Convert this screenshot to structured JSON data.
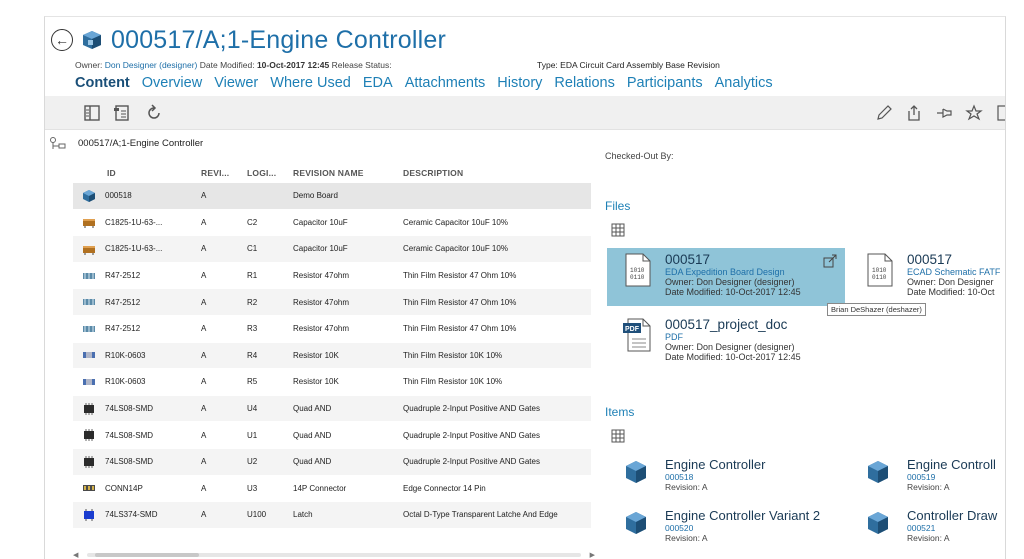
{
  "header": {
    "title": "000517/A;1-Engine Controller",
    "owner_label": "Owner:",
    "owner_value": "Don Designer (designer)",
    "date_label": "Date Modified:",
    "date_value": "10-Oct-2017 12:45",
    "release_label": "Release Status:",
    "type_label": "Type:",
    "type_value": "EDA Circuit Card Assembly Base Revision"
  },
  "tabs": [
    {
      "label": "Content"
    },
    {
      "label": "Overview"
    },
    {
      "label": "Viewer"
    },
    {
      "label": "Where Used"
    },
    {
      "label": "EDA"
    },
    {
      "label": "Attachments"
    },
    {
      "label": "History"
    },
    {
      "label": "Relations"
    },
    {
      "label": "Participants"
    },
    {
      "label": "Analytics"
    }
  ],
  "toolbar": {
    "left_icons": [
      "panel-icon",
      "structure-icon",
      "refresh-icon"
    ],
    "right_icons": [
      "pencil-icon",
      "share-icon",
      "pin-icon",
      "star-icon",
      "page-icon"
    ]
  },
  "breadcrumb": {
    "text": "000517/A;1-Engine Controller"
  },
  "table": {
    "columns": [
      "ID",
      "REVI...",
      "LOGI...",
      "REVISION NAME",
      "DESCRIPTION"
    ],
    "rows": [
      {
        "icon": "assembly",
        "id": "000518",
        "rev": "A",
        "logical": "",
        "name": "Demo Board",
        "desc": ""
      },
      {
        "icon": "capacitor",
        "id": "C1825-1U-63-...",
        "rev": "A",
        "logical": "C2",
        "name": "Capacitor 10uF",
        "desc": "Ceramic Capacitor 10uF 10%"
      },
      {
        "icon": "capacitor",
        "id": "C1825-1U-63-...",
        "rev": "A",
        "logical": "C1",
        "name": "Capacitor 10uF",
        "desc": "Ceramic Capacitor 10uF 10%"
      },
      {
        "icon": "resistor",
        "id": "R47-2512",
        "rev": "A",
        "logical": "R1",
        "name": "Resistor 47ohm",
        "desc": "Thin Film Resistor 47 Ohm 10%"
      },
      {
        "icon": "resistor",
        "id": "R47-2512",
        "rev": "A",
        "logical": "R2",
        "name": "Resistor 47ohm",
        "desc": "Thin Film Resistor 47 Ohm 10%"
      },
      {
        "icon": "resistor",
        "id": "R47-2512",
        "rev": "A",
        "logical": "R3",
        "name": "Resistor 47ohm",
        "desc": "Thin Film Resistor 47 Ohm 10%"
      },
      {
        "icon": "resistor2",
        "id": "R10K-0603",
        "rev": "A",
        "logical": "R4",
        "name": "Resistor 10K",
        "desc": "Thin Film Resistor 10K 10%"
      },
      {
        "icon": "resistor2",
        "id": "R10K-0603",
        "rev": "A",
        "logical": "R5",
        "name": "Resistor 10K",
        "desc": "Thin Film Resistor 10K 10%"
      },
      {
        "icon": "chip",
        "id": "74LS08-SMD",
        "rev": "A",
        "logical": "U4",
        "name": "Quad AND",
        "desc": "Quadruple 2-Input Positive AND Gates"
      },
      {
        "icon": "chip",
        "id": "74LS08-SMD",
        "rev": "A",
        "logical": "U1",
        "name": "Quad AND",
        "desc": "Quadruple 2-Input Positive AND Gates"
      },
      {
        "icon": "chip",
        "id": "74LS08-SMD",
        "rev": "A",
        "logical": "U2",
        "name": "Quad AND",
        "desc": "Quadruple 2-Input Positive AND Gates"
      },
      {
        "icon": "connector",
        "id": "CONN14P",
        "rev": "A",
        "logical": "U3",
        "name": "14P Connector",
        "desc": "Edge Connector 14 Pin"
      },
      {
        "icon": "latch",
        "id": "74LS374-SMD",
        "rev": "A",
        "logical": "U100",
        "name": "Latch",
        "desc": "Octal D-Type Transparent Latche And Edge"
      }
    ]
  },
  "right_panel": {
    "checked_out_label": "Checked-Out By:",
    "files_title": "Files",
    "files": [
      {
        "name": "000517",
        "sub": "EDA Expedition Board Design",
        "owner": "Owner:  Don Designer (designer)",
        "date": "Date Modified:  10-Oct-2017 12:45"
      },
      {
        "name": "000517",
        "sub": "ECAD Schematic FATF",
        "owner": "Owner:  Don Designer",
        "date": "Date Modified:  10-Oct"
      },
      {
        "name": "000517_project_doc",
        "sub": "PDF",
        "owner": "Owner:  Don Designer (designer)",
        "date": "Date Modified:  10-Oct-2017 12:45"
      }
    ],
    "tooltip": "Brian DeShazer (deshazer)",
    "items_title": "Items",
    "items": [
      {
        "name": "Engine Controller",
        "id": "000518",
        "rev": "Revision:  A"
      },
      {
        "name": "Engine Controll",
        "id": "000519",
        "rev": "Revision:  A"
      },
      {
        "name": "Engine Controller Variant 2",
        "id": "000520",
        "rev": "Revision:  A"
      },
      {
        "name": "Controller Draw",
        "id": "000521",
        "rev": "Revision:  A"
      }
    ]
  },
  "colors": {
    "accent": "#1e80b6",
    "title": "#1e6fa8",
    "highlight": "#8fc4d8"
  }
}
